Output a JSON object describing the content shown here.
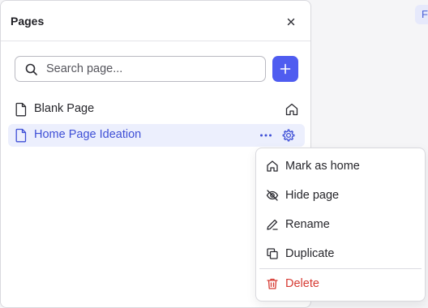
{
  "background": {
    "badge_text": "F"
  },
  "panel": {
    "title": "Pages",
    "close_icon": "close-icon",
    "search": {
      "placeholder": "Search page...",
      "value": ""
    },
    "add_icon": "plus-icon",
    "pages": [
      {
        "label": "Blank Page",
        "icon": "file-icon",
        "is_home": true,
        "selected": false
      },
      {
        "label": "Home Page Ideation",
        "icon": "file-icon",
        "is_home": false,
        "selected": true
      }
    ]
  },
  "context_menu": {
    "items": [
      {
        "label": "Mark as home",
        "icon": "home-icon"
      },
      {
        "label": "Hide page",
        "icon": "eye-off-icon"
      },
      {
        "label": "Rename",
        "icon": "pencil-icon"
      },
      {
        "label": "Duplicate",
        "icon": "copy-icon"
      },
      {
        "label": "Delete",
        "icon": "trash-icon",
        "danger": true
      }
    ]
  },
  "colors": {
    "accent": "#4f5cf0",
    "selected_bg": "#eceffd",
    "selected_text": "#3e4fd6",
    "danger": "#d63a32"
  }
}
